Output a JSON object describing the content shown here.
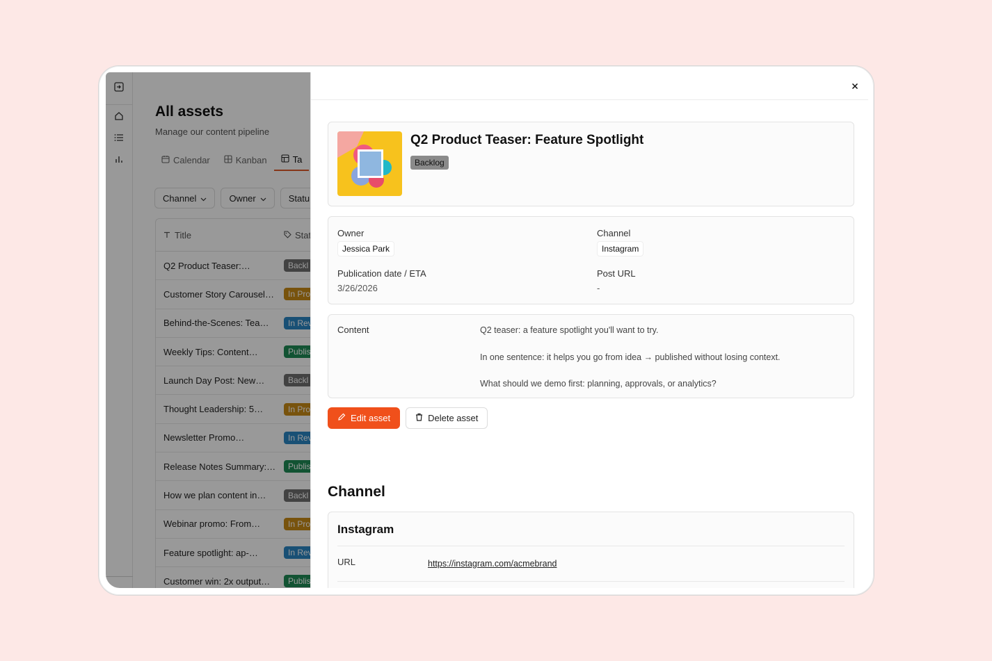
{
  "app": {
    "title": "All assets",
    "subtitle": "Manage our content pipeline",
    "views": [
      {
        "label": "Calendar",
        "icon": "calendar-icon"
      },
      {
        "label": "Kanban",
        "icon": "kanban-icon"
      },
      {
        "label": "Ta",
        "icon": "table-icon"
      }
    ],
    "filters": [
      "Channel",
      "Owner",
      "Statu"
    ],
    "table": {
      "col_title": "Title",
      "col_status": "Stat",
      "rows": [
        {
          "title": "Q2 Product Teaser:…",
          "status": "Backl",
          "color": "#6f6f6f"
        },
        {
          "title": "Customer Story Carousel…",
          "status": "In Pro",
          "color": "#c98a17"
        },
        {
          "title": "Behind-the-Scenes: Tea…",
          "status": "In Rev",
          "color": "#2a86c4"
        },
        {
          "title": "Weekly Tips: Content…",
          "status": "Publis",
          "color": "#1f8a55"
        },
        {
          "title": "Launch Day Post: New…",
          "status": "Backl",
          "color": "#6f6f6f"
        },
        {
          "title": "Thought Leadership: 5…",
          "status": "In Pro",
          "color": "#c98a17"
        },
        {
          "title": "Newsletter Promo…",
          "status": "In Rev",
          "color": "#2a86c4"
        },
        {
          "title": "Release Notes Summary:…",
          "status": "Publis",
          "color": "#1f8a55"
        },
        {
          "title": "How we plan content in…",
          "status": "Backl",
          "color": "#6f6f6f"
        },
        {
          "title": "Webinar promo: From…",
          "status": "In Pro",
          "color": "#c98a17"
        },
        {
          "title": "Feature spotlight: ap-…",
          "status": "In Rev",
          "color": "#2a86c4"
        },
        {
          "title": "Customer win: 2x output…",
          "status": "Publis",
          "color": "#1f8a55"
        }
      ]
    }
  },
  "drawer": {
    "close_icon": "close-icon",
    "asset": {
      "title": "Q2 Product Teaser: Feature Spotlight",
      "status": "Backlog"
    },
    "meta": {
      "owner_label": "Owner",
      "owner_value": "Jessica Park",
      "channel_label": "Channel",
      "channel_value": "Instagram",
      "pubdate_label": "Publication date / ETA",
      "pubdate_value": "3/26/2026",
      "posturl_label": "Post URL",
      "posturl_value": "-"
    },
    "content": {
      "label": "Content",
      "lines": [
        "Q2 teaser: a feature spotlight you'll want to try.",
        "In one sentence: it helps you go from idea → published without losing context.",
        "What should we demo first: planning, approvals, or analytics?"
      ]
    },
    "actions": {
      "edit_label": "Edit asset",
      "delete_label": "Delete asset"
    },
    "channel_section": {
      "title": "Channel",
      "name": "Instagram",
      "url_label": "URL",
      "url_value": "https://instagram.com/acmebrand"
    }
  },
  "colors": {
    "background": "#fde8e6",
    "accent": "#f0501b",
    "tab_underline": "#e05a2a",
    "backlog_badge": "#8a8a8a"
  }
}
